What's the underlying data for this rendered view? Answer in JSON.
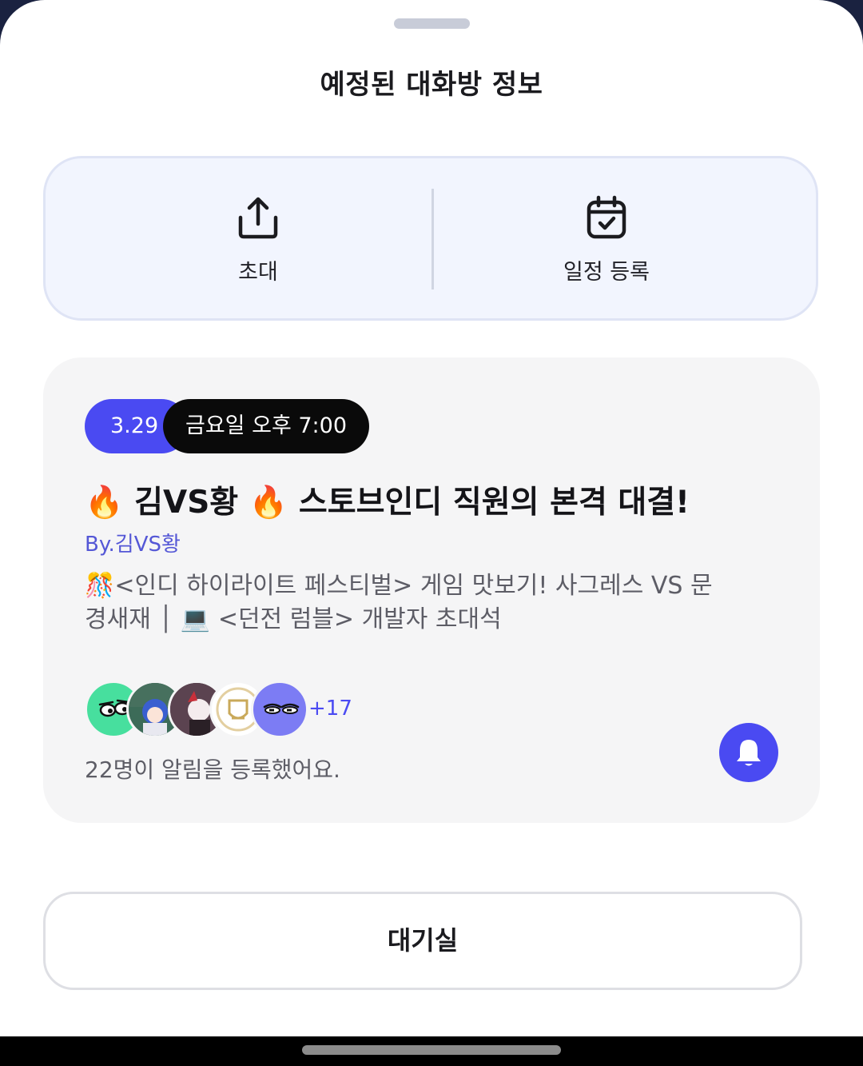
{
  "sheet": {
    "title": "예정된 대화방 정보"
  },
  "actions": {
    "invite": {
      "label": "초대",
      "icon": "share-upload-icon"
    },
    "schedule": {
      "label": "일정 등록",
      "icon": "calendar-check-icon"
    }
  },
  "room": {
    "date": "3.29",
    "time": "금요일 오후 7:00",
    "title": "🔥 김VS황 🔥 스토브인디 직원의 본격 대결!",
    "author": "By.김VS황",
    "description": "🎊<인디 하이라이트 페스티벌> 게임 맛보기! 사그레스 VS 문경새재 │ 💻 <던전 럼블> 개발자 초대석",
    "participants": {
      "extra_count": "+17",
      "notify_text": "22명이 알림을 등록했어요."
    },
    "bell_icon": "bell-icon"
  },
  "footer": {
    "wait_room_label": "대기실"
  },
  "colors": {
    "accent": "#4a4af2",
    "author": "#5457d6",
    "panel_bg": "#f2f5fe",
    "card_bg": "#f5f5f6"
  }
}
